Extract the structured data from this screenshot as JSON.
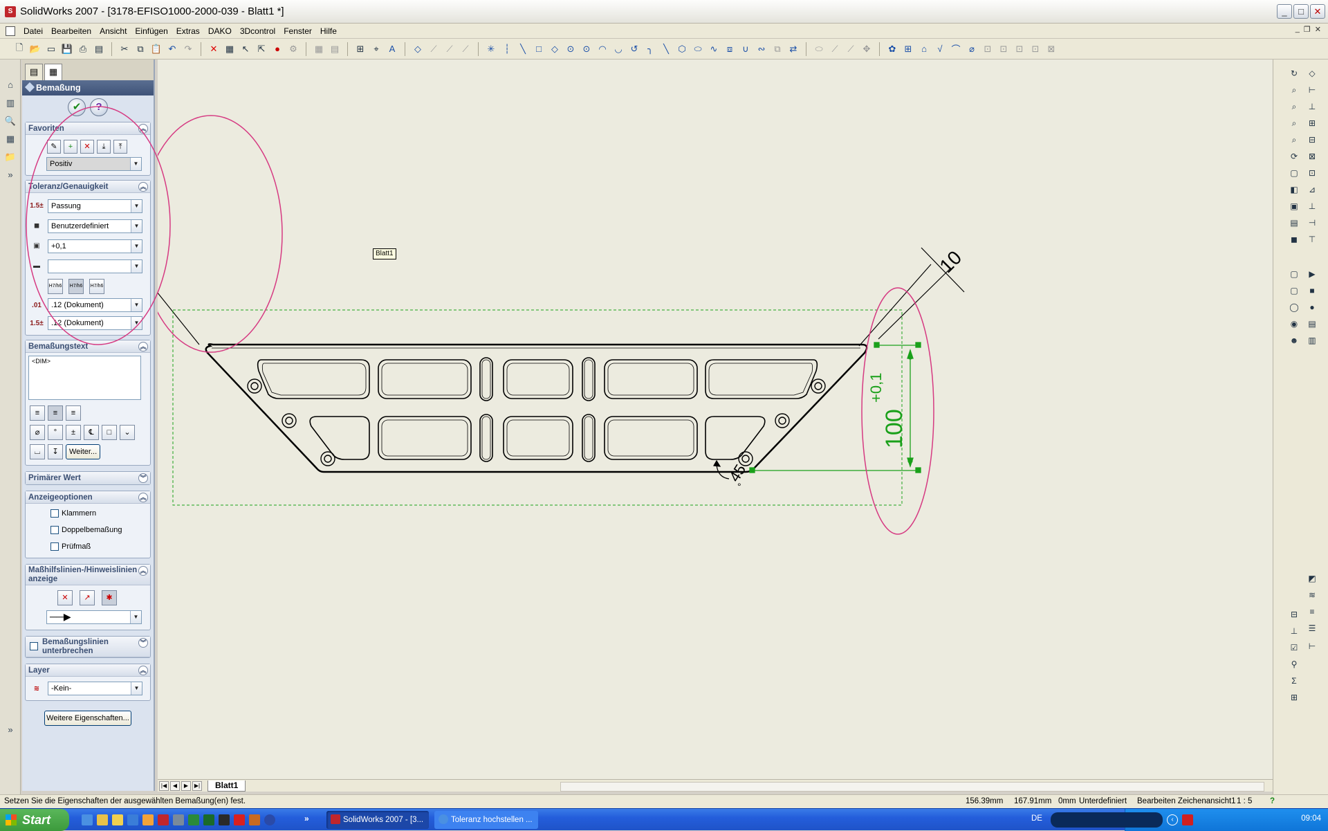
{
  "window": {
    "title": "SolidWorks 2007 - [3178-EFISO1000-2000-039 - Blatt1 *]",
    "controls": [
      "_",
      "□",
      "✕"
    ]
  },
  "menu": {
    "items": [
      "Datei",
      "Bearbeiten",
      "Ansicht",
      "Einfügen",
      "Extras",
      "DAKO",
      "3Dcontrol",
      "Fenster",
      "Hilfe"
    ]
  },
  "panel": {
    "header": "Bemaßung",
    "favoriten": {
      "title": "Favoriten",
      "selected": "Positiv"
    },
    "toleranz": {
      "title": "Toleranz/Genauigkeit",
      "type": "Passung",
      "class": "Benutzerdefiniert",
      "upper": "+0,1",
      "lower": "",
      "precision1": ".12 (Dokument)",
      "precision2": ".12 (Dokument)",
      "fitlabels": [
        "H7/h6",
        "H7/h6",
        "H7/h6"
      ]
    },
    "bemassungstext": {
      "title": "Bemaßungstext",
      "value": "<DIM>",
      "weiter": "Weiter..."
    },
    "primaer": {
      "title": "Primärer Wert"
    },
    "anzeige": {
      "title": "Anzeigeoptionen",
      "opts": [
        "Klammern",
        "Doppelbemaßung",
        "Prüfmaß"
      ]
    },
    "masshilf": {
      "title": "Maßhilfslinien-/Hinweislinien anzeige"
    },
    "unterbrechen": {
      "title": "Bemaßungslinien unterbrechen"
    },
    "layer": {
      "title": "Layer",
      "value": "-Kein-"
    },
    "more": "Weitere Eigenschaften..."
  },
  "canvas": {
    "sheet_tooltip": "Blatt1",
    "dim_100": "100",
    "dim_tol": "+0,1",
    "dim_10": "10",
    "dim_45": "45",
    "deg": "°"
  },
  "sheet_tab": "Blatt1",
  "status": {
    "message": "Setzen Sie die Eigenschaften der ausgewählten Bemaßung(en) fest.",
    "x": "156.39mm",
    "y": "167.91mm",
    "z": "0mm",
    "state": "Unterdefiniert",
    "mode": "Bearbeiten Zeichenansicht1",
    "scale": "1 : 5",
    "help": "?"
  },
  "taskbar": {
    "start": "Start",
    "tasks": [
      "SolidWorks 2007 - [3...",
      "Toleranz hochstellen ..."
    ],
    "lang": "DE",
    "clock": "09:04"
  }
}
